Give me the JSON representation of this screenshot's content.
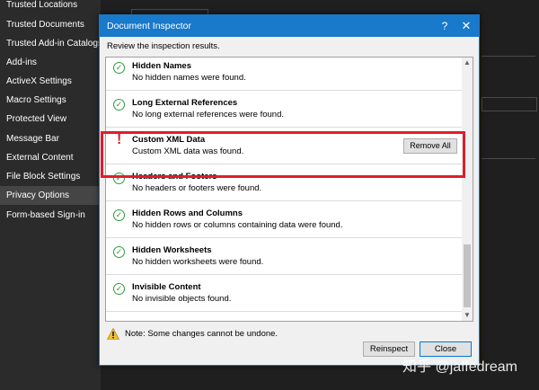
{
  "sidebar": {
    "items": [
      {
        "label": "Trusted Locations"
      },
      {
        "label": "Trusted Documents"
      },
      {
        "label": "Trusted Add-in Catalogs"
      },
      {
        "label": "Add-ins"
      },
      {
        "label": "ActiveX Settings"
      },
      {
        "label": "Macro Settings"
      },
      {
        "label": "Protected View"
      },
      {
        "label": "Message Bar"
      },
      {
        "label": "External Content"
      },
      {
        "label": "File Block Settings"
      },
      {
        "label": "Privacy Options",
        "active": true
      },
      {
        "label": "Form-based Sign-in"
      }
    ]
  },
  "dialog": {
    "title": "Document Inspector",
    "help_glyph": "?",
    "close_glyph": "✕",
    "instruction": "Review the inspection results.",
    "results": [
      {
        "title": "Hidden Names",
        "description": "No hidden names were found.",
        "status": "ok"
      },
      {
        "title": "Long External References",
        "description": "No long external references were found.",
        "status": "ok"
      },
      {
        "title": "Custom XML Data",
        "description": "Custom XML data was found.",
        "status": "found",
        "action": "Remove All"
      },
      {
        "title": "Headers and Footers",
        "description": "No headers or footers were found.",
        "status": "ok"
      },
      {
        "title": "Hidden Rows and Columns",
        "description": "No hidden rows or columns containing data were found.",
        "status": "ok"
      },
      {
        "title": "Hidden Worksheets",
        "description": "No hidden worksheets were found.",
        "status": "ok"
      },
      {
        "title": "Invisible Content",
        "description": "No invisible objects found.",
        "status": "ok"
      }
    ],
    "note": "Note: Some changes cannot be undone.",
    "reinspect_label": "Reinspect",
    "close_label": "Close"
  },
  "watermark": "知乎 @jaffedream",
  "colors": {
    "accent": "#1979ca",
    "ok": "#2e9b3a",
    "warning": "#d0232b",
    "highlight": "#e01e2b"
  }
}
